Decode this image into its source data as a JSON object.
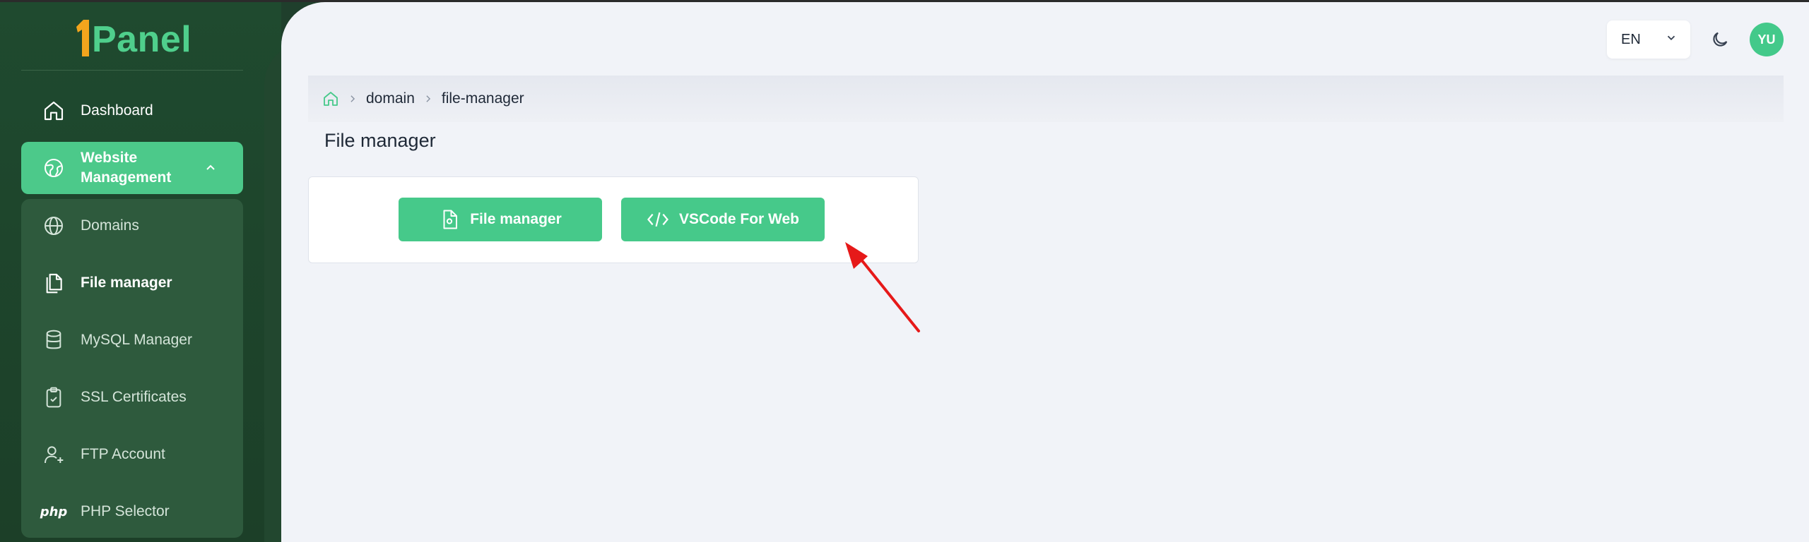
{
  "brand": {
    "logo_text": "Panel"
  },
  "sidebar": {
    "items": [
      {
        "label": "Dashboard"
      },
      {
        "label": "Website Management"
      }
    ],
    "submenu": [
      {
        "label": "Domains"
      },
      {
        "label": "File manager"
      },
      {
        "label": "MySQL Manager"
      },
      {
        "label": "SSL Certificates"
      },
      {
        "label": "FTP Account"
      },
      {
        "label": "PHP Selector",
        "icon_text": "php"
      }
    ]
  },
  "header": {
    "language": "EN",
    "avatar_initials": "YU"
  },
  "breadcrumb": {
    "items": [
      "domain",
      "file-manager"
    ]
  },
  "page": {
    "title": "File manager",
    "buttons": {
      "file_manager": "File manager",
      "vscode": "VSCode For Web"
    }
  },
  "colors": {
    "accent": "#46c98a",
    "sidebar_bg": "#1f4a2f",
    "annotation_arrow": "#e61919"
  }
}
